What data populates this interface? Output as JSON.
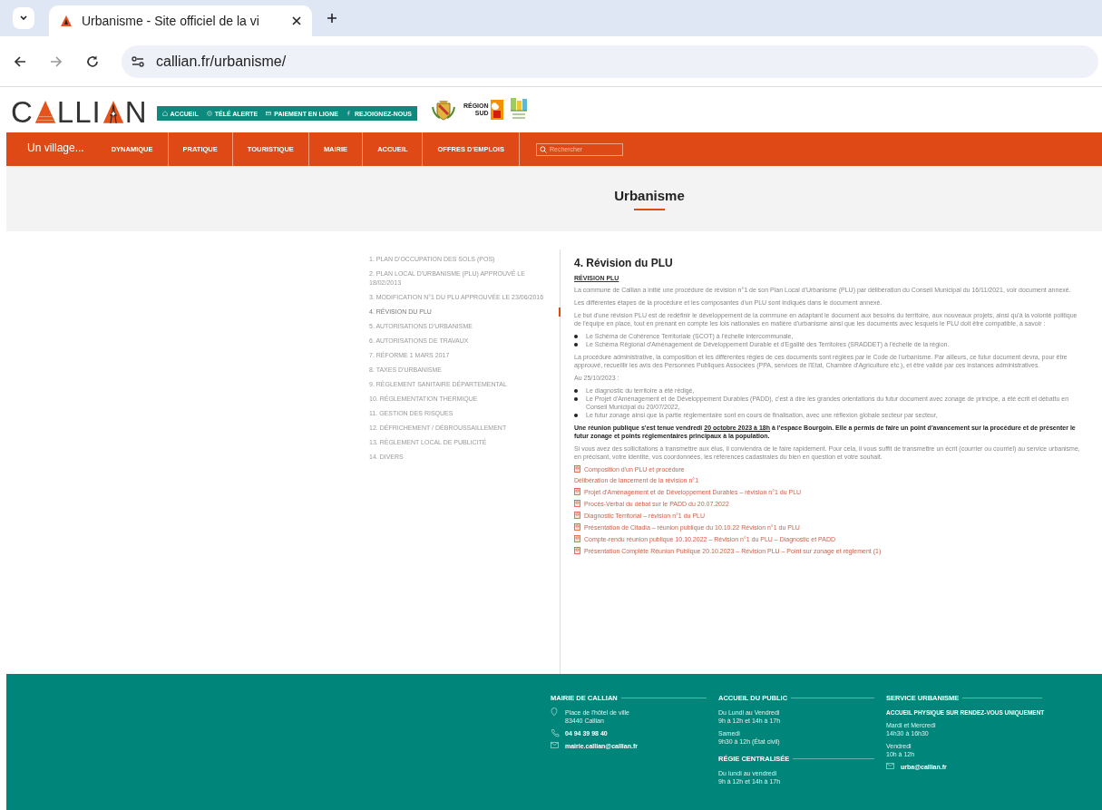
{
  "browser": {
    "tab_title": "Urbanisme - Site officiel de la vi",
    "url": "callian.fr/urbanisme/"
  },
  "header": {
    "logo_letters": [
      "C",
      "LLI",
      "N"
    ],
    "quick_links": [
      {
        "kind": "home",
        "label": "ACCUEIL"
      },
      {
        "kind": "alert",
        "label": "TÉLÉ ALERTE"
      },
      {
        "kind": "card",
        "label": "PAIEMENT EN LIGNE"
      },
      {
        "kind": "facebook",
        "label": "REJOIGNEZ-NOUS"
      }
    ],
    "partner_text": [
      "RÉGION",
      "SUD"
    ]
  },
  "nav": {
    "brand": "Un village...",
    "items": [
      "DYNAMIQUE",
      "PRATIQUE",
      "TOURISTIQUE",
      "MAIRIE",
      "ACCUEIL",
      "OFFRES D'EMPLOIS"
    ],
    "search_placeholder": "Rechercher"
  },
  "page_title": "Urbanisme",
  "sidebar": {
    "items": [
      {
        "label": "1. PLAN D'OCCUPATION DES SOLS (POS)",
        "selected": false
      },
      {
        "label": "2. PLAN LOCAL D'URBANISME (PLU) APPROUVÉ LE 18/02/2013",
        "selected": false
      },
      {
        "label": "3. MODIFICATION N°1 DU PLU APPROUVÉE LE 23/06/2016",
        "selected": false
      },
      {
        "label": "4. RÉVISION DU PLU",
        "selected": true
      },
      {
        "label": "5. AUTORISATIONS D'URBANISME",
        "selected": false
      },
      {
        "label": "6. AUTORISATIONS DE TRAVAUX",
        "selected": false
      },
      {
        "label": "7. RÉFORME 1 MARS 2017",
        "selected": false
      },
      {
        "label": "8. TAXES D'URBANISME",
        "selected": false
      },
      {
        "label": "9. RÈGLEMENT SANITAIRE DÉPARTEMENTAL",
        "selected": false
      },
      {
        "label": "10. RÉGLEMENTATION THERMIQUE",
        "selected": false
      },
      {
        "label": "11. GESTION DES RISQUES",
        "selected": false
      },
      {
        "label": "12. DÉFRICHEMENT / DÉBROUSSAILLEMENT",
        "selected": false
      },
      {
        "label": "13. RÈGLEMENT LOCAL DE PUBLICITÉ",
        "selected": false
      },
      {
        "label": "14. DIVERS",
        "selected": false
      }
    ]
  },
  "article": {
    "heading": "4. Révision du PLU",
    "subheading": "RÉVISION PLU",
    "blocks": [
      {
        "kind": "p",
        "text": "La commune de Callian a initié une procédure de révision n°1 de son Plan Local d'Urbanisme (PLU) par délibération du Conseil Municipal du 16/11/2021, voir document annexé."
      },
      {
        "kind": "p",
        "text": "Les différentes étapes de la procédure et les composantes d'un PLU sont indiqués dans le document annexé."
      },
      {
        "kind": "p",
        "text": "Le but d'une révision PLU est de redéfinir le développement de la commune en adaptant le document aux besoins du territoire, aux nouveaux projets, ainsi qu'à la volonté politique de l'équipe en place, tout en prenant en compte les lois nationales en matière d'urbanisme ainsi que les documents avec lesquels le PLU doit être compatible, à savoir :"
      },
      {
        "kind": "list",
        "items": [
          "Le Schéma de Cohérence Territoriale (SCOT) à l'échelle intercommunale,",
          "Le Schéma Régional d'Aménagement de Développement Durable et d'Egalité des Territoires (SRADDET) à l'échelle de la région."
        ]
      },
      {
        "kind": "p",
        "text": "La procédure administrative, la composition et les différentes règles de ces documents sont réglées par le Code de l'urbanisme. Par ailleurs, ce futur document devra, pour être approuvé, recueillir les avis des Personnes Publiques Associées (PPA, services de l'Etat, Chambre d'Agriculture etc.), et être validé par ces instances administratives."
      },
      {
        "kind": "p",
        "text": "Au 25/10/2023 :"
      },
      {
        "kind": "list",
        "items": [
          "Le diagnostic du territoire a été rédigé,",
          "Le Projet d'Aménagement et de Développement Durables (PADD), c'est à dire les grandes orientations du futur document avec zonage de principe, a été écrit et débattu en Conseil Municipal du 20/07/2022,",
          "Le futur zonage ainsi que la partie réglementaire sont en cours de finalisation, avec une réflexion globale secteur par secteur,"
        ]
      },
      {
        "kind": "notice",
        "before": "Une réunion publique s'est tenue vendredi",
        "link": "20 octobre 2023 à 18h",
        "after": "à l'espace Bourgoin. Elle a permis de faire un point d'avancement sur la procédure et de présenter le futur zonage et points réglementaires principaux à la population."
      },
      {
        "kind": "p",
        "text": "Si vous avez des sollicitations à transmettre aux élus, il conviendra de le faire rapidement. Pour cela, il vous suffit de transmettre un écrit (courrier ou courriel) au service urbanisme, en précisant, votre identité, vos coordonnées, les références cadastrales du bien en question et votre souhait."
      }
    ],
    "documents": [
      {
        "kind": "file",
        "label": "Composition d'un PLU et procédure"
      },
      {
        "kind": "text",
        "label": "Délibération de lancement de la révision n°1"
      },
      {
        "kind": "file",
        "label": "Projet d'Aménagement et de Développement Durables – révision n°1 du PLU"
      },
      {
        "kind": "file",
        "label": "Procès-Verbal du débat sur le PADD du 20.07.2022"
      },
      {
        "kind": "file",
        "label": "Diagnostic Territorial – révision n°1 du PLU"
      },
      {
        "kind": "file",
        "label": "Présentation de Citadia – réunion publique du 10.10.22 Révision n°1 du PLU"
      },
      {
        "kind": "file",
        "label": "Compte-rendu réunion publique 10.10.2022 – Révision n°1 du PLU – Diagnostic et PADD"
      },
      {
        "kind": "file",
        "label": "Présentation Complète Réunion Publique 20.10.2023 – Révision PLU – Point sur zonage et règlement (1)"
      }
    ]
  },
  "footer": {
    "columns": [
      {
        "sections": [
          {
            "title": "MAIRIE DE CALLIAN",
            "lines": [
              {
                "kind": "address",
                "text": "Place de l'hôtel de ville\n83440 Callian"
              },
              {
                "kind": "phone",
                "text": "04 94 39 98 40"
              },
              {
                "kind": "email",
                "text": "mairie.callian@callian.fr"
              }
            ]
          }
        ]
      },
      {
        "sections": [
          {
            "title": "ACCUEIL DU PUBLIC",
            "lines": [
              {
                "kind": "hours",
                "text": "Du Lundi au Vendredi\n9h à 12h et 14h à 17h"
              },
              {
                "kind": "hours",
                "text": "Samedi\n9h30 à 12h (État civil)"
              }
            ]
          },
          {
            "title": "RÉGIE CENTRALISÉE",
            "lines": [
              {
                "kind": "hours",
                "text": "Du lundi au vendredi\n9h à 12h et 14h à 17h"
              }
            ]
          }
        ]
      },
      {
        "sections": [
          {
            "title": "SERVICE URBANISME",
            "lines": [
              {
                "kind": "notice",
                "text": "ACCUEIL PHYSIQUE SUR RENDEZ-VOUS UNIQUEMENT"
              },
              {
                "kind": "hours",
                "text": "Mardi et Mercredi\n14h30 à 16h30"
              },
              {
                "kind": "hours",
                "text": "Vendredi\n10h à 12h"
              },
              {
                "kind": "email",
                "text": "urba@callian.fr"
              }
            ]
          }
        ]
      }
    ]
  }
}
